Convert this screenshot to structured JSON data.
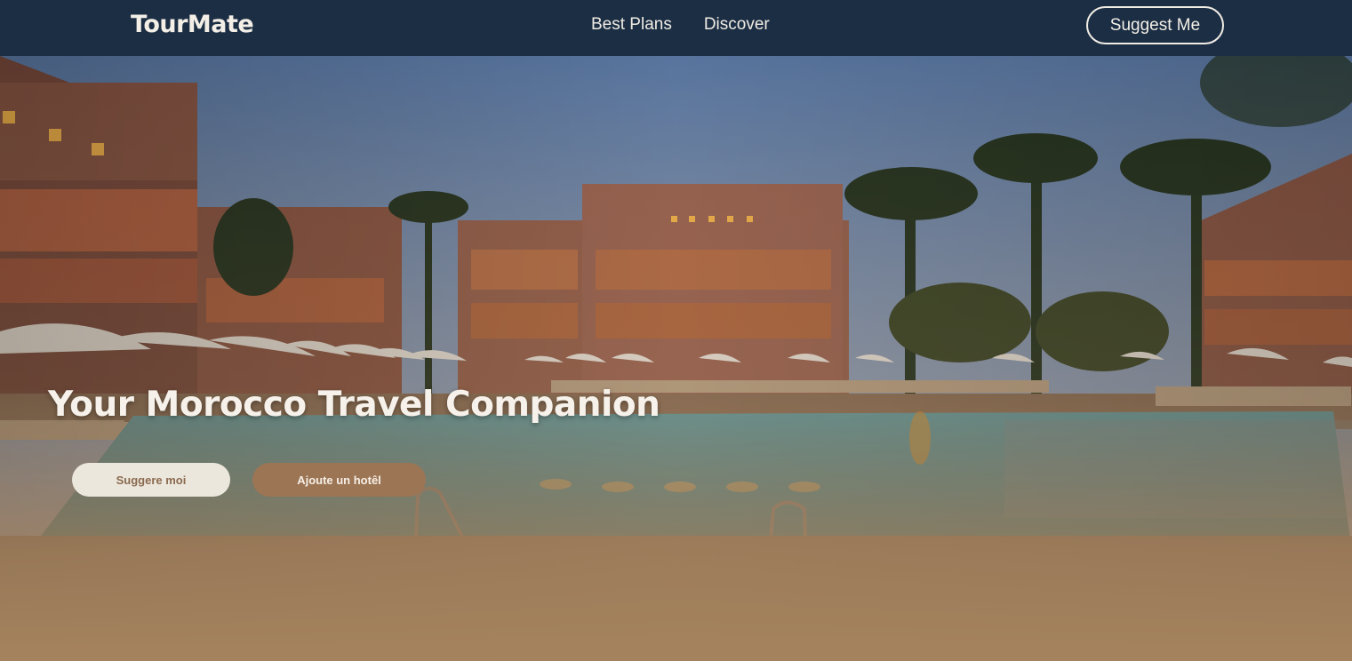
{
  "navbar": {
    "brand": "TourMate",
    "links": [
      "Best Plans",
      "Discover"
    ],
    "cta_label": "Suggest Me"
  },
  "hero": {
    "title": "Your Morocco Travel Companion",
    "primary_button": "Suggere moi",
    "secondary_button": "Ajoute un hotêl"
  },
  "colors": {
    "navbar_bg": "#1c2e44",
    "text_light": "#f3efe7",
    "primary_button_bg": "#ece7dd",
    "primary_button_text": "#8a6a4e",
    "secondary_button_bg": "#9c7555",
    "fade_tone": "#a5835e"
  }
}
